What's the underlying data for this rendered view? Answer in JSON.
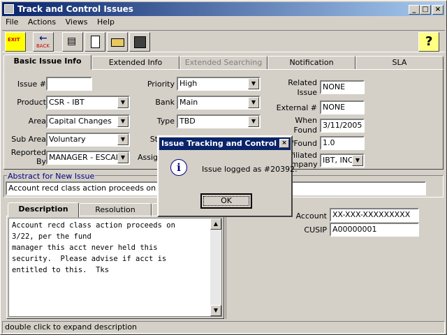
{
  "window": {
    "title": "Track and Control Issues"
  },
  "menu": [
    "File",
    "Actions",
    "Views",
    "Help"
  ],
  "toolbar": {
    "exit_label": "EXIT",
    "back_label": "BACK",
    "help_label": "?"
  },
  "tabs": [
    "Basic Issue Info",
    "Extended Info",
    "Extended Searching",
    "Notification",
    "SLA"
  ],
  "form": {
    "issue_label": "Issue #",
    "issue_value": "",
    "product_label": "Product",
    "product_value": "CSR - IBT",
    "area_label": "Area",
    "area_value": "Capital Changes",
    "subarea_label": "Sub Area",
    "subarea_value": "Voluntary",
    "reported_label": "Reported\nBy",
    "reported_value": "MANAGER - ESCAL/",
    "priority_label": "Priority",
    "priority_value": "High",
    "bank_label": "Bank",
    "bank_value": "Main",
    "type_label": "Type",
    "type_value": "TBD",
    "status_label_partial": "St",
    "assigned_label_partial": "Assig",
    "related_label": "Related\nIssue",
    "related_value": "NONE",
    "external_label": "External #",
    "external_value": "NONE",
    "when_found_label": "When\nFound",
    "when_found_value": "3/11/2005",
    "ver_found_label_partial": "/Found",
    "ver_found_value": "1.0",
    "affiliated_label_partial": "filiated\nompany",
    "affiliated_value": "IBT, INC"
  },
  "abstract": {
    "legend": "Abstract for New Issue",
    "value": "Account recd class action proceeds on 3/2"
  },
  "lower_tabs": [
    "Description",
    "Resolution"
  ],
  "description": "Account recd class action proceeds on\n3/22, per the fund\nmanager this acct never held this\nsecurity.  Please advise if acct is\nentitled to this.  Tks",
  "account": {
    "account_label": "Account",
    "account_value": "XX-XXX-XXXXXXXXX",
    "cusip_label": "CUSIP",
    "cusip_value": "A00000001"
  },
  "status_text": "double click to expand description",
  "dialog": {
    "title": "Issue Tracking and Control",
    "message": "Issue logged as #20392.",
    "ok_label": "OK"
  }
}
